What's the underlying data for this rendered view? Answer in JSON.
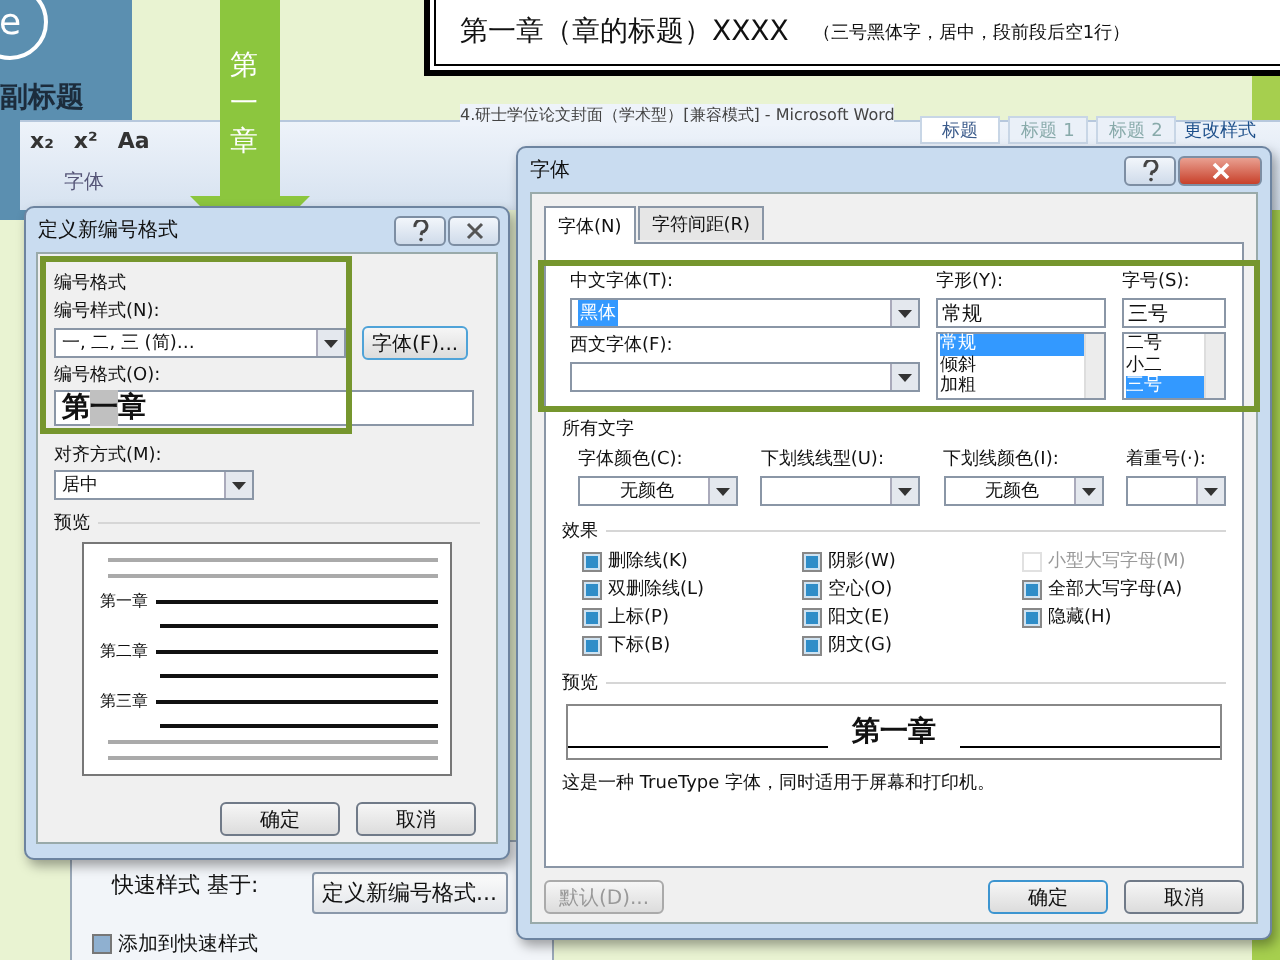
{
  "background": {
    "badge": "e",
    "subtitle": "副标题"
  },
  "heading_sample": {
    "title": "第一章（章的标题）XXXX",
    "note": "（三号黑体字，居中，段前段后空1行）"
  },
  "arrow_label": "第一章",
  "ribbon": {
    "window_title": "4.研士学位论文封面（学术型）[兼容模式] - Microsoft Word",
    "buttons": [
      "x₂",
      "x²",
      "Aa"
    ],
    "group_label": "字体",
    "styles": [
      {
        "label": "标题",
        "selected": true
      },
      {
        "label": "标题 1",
        "selected": false
      },
      {
        "label": "标题 2",
        "selected": false
      }
    ],
    "change_styles": "更改样式"
  },
  "numbering_dialog": {
    "title": "定义新编号格式",
    "group": "编号格式",
    "style_label": "编号样式(N):",
    "style_value": "一, 二, 三 (简)…",
    "font_button": "字体(F)...",
    "format_label": "编号格式(O):",
    "format_before": "第",
    "format_number": "一",
    "format_after": "章",
    "align_label": "对齐方式(M):",
    "align_value": "居中",
    "preview_label": "预览",
    "preview_items": [
      "第一章",
      "第二章",
      "第三章"
    ],
    "ok": "确定",
    "cancel": "取消"
  },
  "behind": {
    "quick_style": "快速样式 基于:",
    "define_button": "定义新编号格式...",
    "add_checkbox": {
      "label": "添加到快速样式",
      "checked": true
    }
  },
  "font_dialog": {
    "title": "字体",
    "tabs": [
      {
        "label": "字体(N)",
        "selected": true
      },
      {
        "label": "字符间距(R)",
        "selected": false
      }
    ],
    "cn_font_label": "中文字体(T):",
    "cn_font_value": "黑体",
    "west_font_label": "西文字体(F):",
    "style_label": "字形(Y):",
    "style_value": "常规",
    "style_options": [
      {
        "label": "常规",
        "selected": true
      },
      {
        "label": "倾斜",
        "selected": false
      },
      {
        "label": "加粗",
        "selected": false
      }
    ],
    "size_label": "字号(S):",
    "size_value": "三号",
    "size_options": [
      {
        "label": "二号",
        "selected": false
      },
      {
        "label": "小二",
        "selected": false
      },
      {
        "label": "三号",
        "selected": true
      }
    ],
    "all_text": "所有文字",
    "color_label": "字体颜色(C):",
    "color_value": "无颜色",
    "underline_label": "下划线线型(U):",
    "underline_color_label": "下划线颜色(I):",
    "underline_color_value": "无颜色",
    "emphasis_label": "着重号(·):",
    "effects_label": "效果",
    "effects": [
      {
        "label": "删除线(K)",
        "mixed": true,
        "disabled": false
      },
      {
        "label": "双删除线(L)",
        "mixed": true,
        "disabled": false
      },
      {
        "label": "上标(P)",
        "mixed": true,
        "disabled": false
      },
      {
        "label": "下标(B)",
        "mixed": true,
        "disabled": false
      },
      {
        "label": "阴影(W)",
        "mixed": true,
        "disabled": false
      },
      {
        "label": "空心(O)",
        "mixed": true,
        "disabled": false
      },
      {
        "label": "阳文(E)",
        "mixed": true,
        "disabled": false
      },
      {
        "label": "阴文(G)",
        "mixed": true,
        "disabled": false
      },
      {
        "label": "小型大写字母(M)",
        "mixed": false,
        "disabled": true
      },
      {
        "label": "全部大写字母(A)",
        "mixed": true,
        "disabled": false
      },
      {
        "label": "隐藏(H)",
        "mixed": true,
        "disabled": false
      }
    ],
    "preview_label": "预览",
    "preview_text": "第一章",
    "info": "这是一种 TrueType 字体，同时适用于屏幕和打印机。",
    "default_button": "默认(D)...",
    "ok": "确定",
    "cancel": "取消"
  }
}
